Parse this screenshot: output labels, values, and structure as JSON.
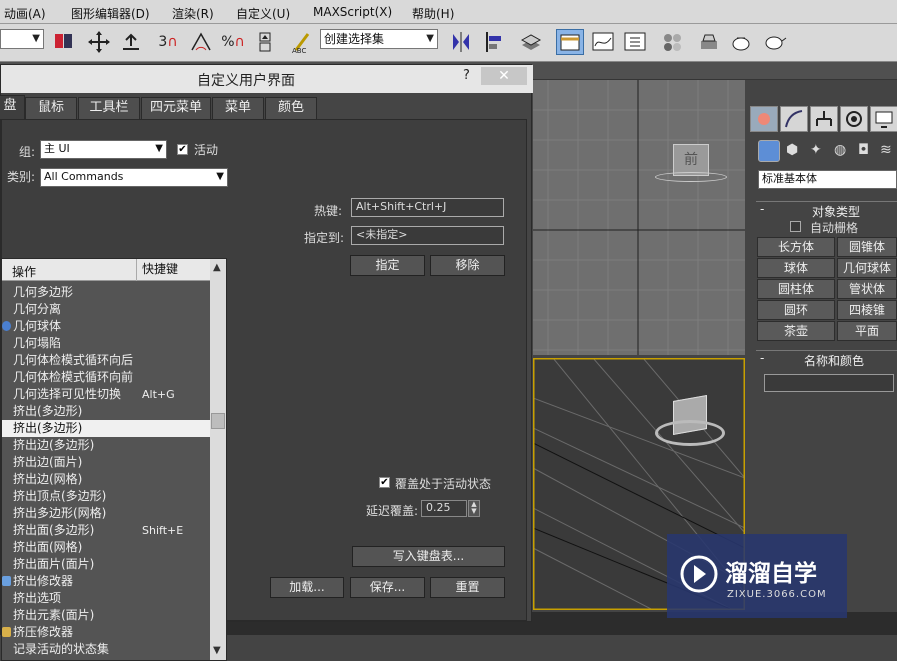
{
  "menu": [
    "动画(A)",
    "图形编辑器(D)",
    "渲染(R)",
    "自定义(U)",
    "MAXScript(X)",
    "帮助(H)"
  ],
  "toolbar": {
    "selection_set_placeholder": "创建选择集",
    "snap_3_label": "3",
    "percent_label": "%"
  },
  "dialog": {
    "title": "自定义用户界面",
    "help_glyph": "?",
    "close_glyph": "✕",
    "tabs": [
      "盘",
      "鼠标",
      "工具栏",
      "四元菜单",
      "菜单",
      "颜色"
    ],
    "group_label": "组:",
    "group_value": "主 UI",
    "active_label": "活动",
    "category_label": "类别:",
    "category_value": "All Commands",
    "list_headers": {
      "action": "操作",
      "hotkey": "快捷键"
    },
    "list_rows": [
      {
        "action": "几何多边形",
        "hotkey": ""
      },
      {
        "action": "几何分离",
        "hotkey": ""
      },
      {
        "action": "几何球体",
        "hotkey": "",
        "icon": "sphere-icon"
      },
      {
        "action": "几何塌陷",
        "hotkey": ""
      },
      {
        "action": "几何体检模式循环向后",
        "hotkey": ""
      },
      {
        "action": "几何体检模式循环向前",
        "hotkey": ""
      },
      {
        "action": "几何选择可见性切换",
        "hotkey": "Alt+G"
      },
      {
        "action": "挤出(多边形)",
        "hotkey": ""
      },
      {
        "action": "挤出(多边形)",
        "hotkey": "",
        "selected": true
      },
      {
        "action": "挤出边(多边形)",
        "hotkey": ""
      },
      {
        "action": "挤出边(面片)",
        "hotkey": ""
      },
      {
        "action": "挤出边(网格)",
        "hotkey": ""
      },
      {
        "action": "挤出顶点(多边形)",
        "hotkey": ""
      },
      {
        "action": "挤出多边形(网格)",
        "hotkey": ""
      },
      {
        "action": "挤出面(多边形)",
        "hotkey": "Shift+E"
      },
      {
        "action": "挤出面(网格)",
        "hotkey": ""
      },
      {
        "action": "挤出面片(面片)",
        "hotkey": ""
      },
      {
        "action": "挤出修改器",
        "hotkey": "",
        "icon": "modifier-icon"
      },
      {
        "action": "挤出选项",
        "hotkey": ""
      },
      {
        "action": "挤出元素(面片)",
        "hotkey": ""
      },
      {
        "action": "挤压修改器",
        "hotkey": "",
        "icon": "squeeze-icon"
      },
      {
        "action": "记录活动的状态集",
        "hotkey": ""
      }
    ],
    "hotkey_label": "热键:",
    "hotkey_value": "Alt+Shift+Ctrl+J",
    "assigned_label": "指定到:",
    "assigned_value": "<未指定>",
    "assign_button": "指定",
    "remove_button": "移除",
    "override_label": "覆盖处于活动状态",
    "delay_label": "延迟覆盖:",
    "delay_value": "0.25",
    "write_button": "写入键盘表...",
    "load_button": "加载...",
    "save_button": "保存...",
    "reset_button": "重置"
  },
  "viewport": {
    "front_cube_label": "前"
  },
  "command_panel": {
    "category_value": "标准基本体",
    "object_type_header": "对象类型",
    "auto_grid_label": "自动栅格",
    "object_buttons": [
      "长方体",
      "圆锥体",
      "球体",
      "几何球体",
      "圆柱体",
      "管状体",
      "圆环",
      "四棱锥",
      "茶壶",
      "平面"
    ],
    "name_color_header": "名称和颜色"
  },
  "watermark": {
    "title": "溜溜自学",
    "url": "ZIXUE.3066.COM"
  },
  "colors": {
    "selection_highlight": "#f0f0f0",
    "dialog_bg": "#3e3e3e",
    "viewport_border": "#c8a000"
  }
}
